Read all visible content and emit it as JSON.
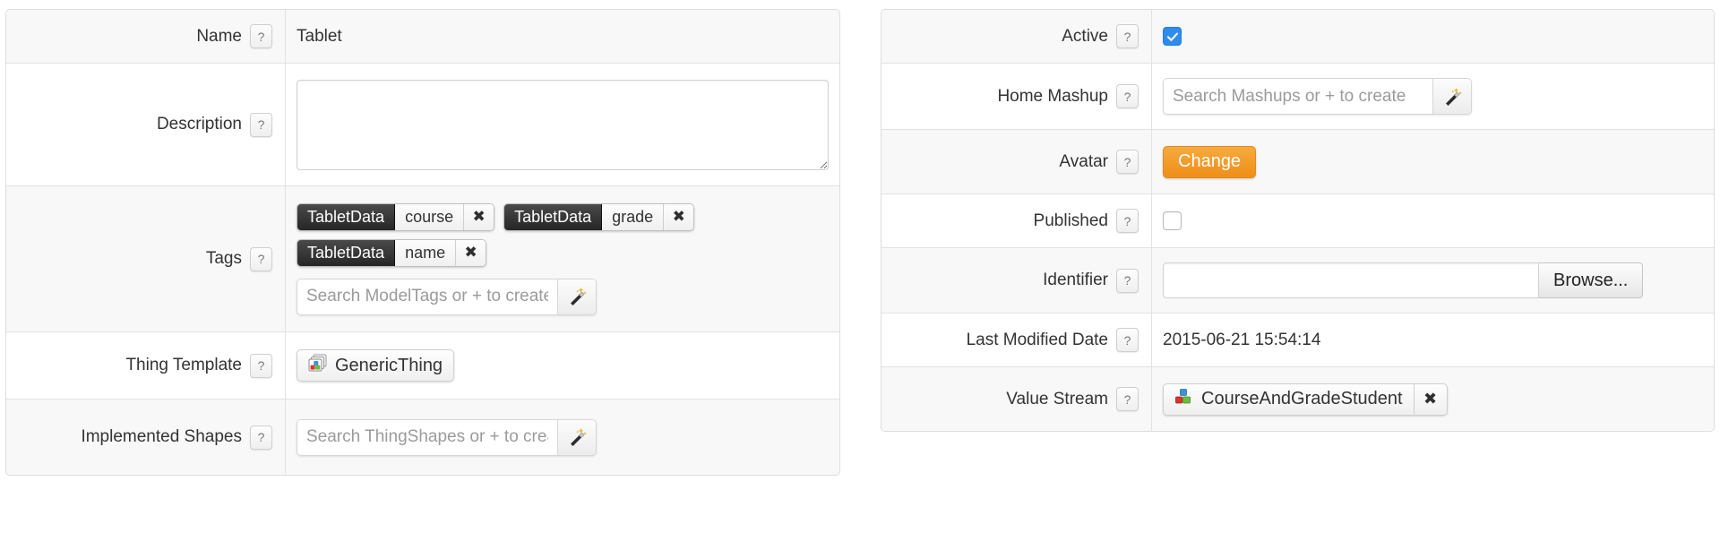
{
  "left_panel": {
    "rows": [
      {
        "label": "Name",
        "help": "?",
        "type": "text",
        "value": "Tablet"
      },
      {
        "label": "Description",
        "help": "?",
        "type": "textarea",
        "value": ""
      },
      {
        "label": "Tags",
        "help": "?",
        "type": "tags",
        "tags": [
          {
            "vocabulary": "TabletData",
            "term": "course",
            "remove_icon": "✖"
          },
          {
            "vocabulary": "TabletData",
            "term": "grade",
            "remove_icon": "✖"
          },
          {
            "vocabulary": "TabletData",
            "term": "name",
            "remove_icon": "✖"
          }
        ],
        "search_placeholder": "Search ModelTags or + to create",
        "search_value": "",
        "wand_icon": "magic-wand-icon"
      },
      {
        "label": "Thing Template",
        "help": "?",
        "type": "chip",
        "chip_label": "GenericThing",
        "chip_icon": "thing-template-icon"
      },
      {
        "label": "Implemented Shapes",
        "help": "?",
        "type": "search",
        "search_placeholder": "Search ThingShapes or + to create",
        "search_value": "",
        "wand_icon": "magic-wand-icon"
      }
    ]
  },
  "right_panel": {
    "rows": [
      {
        "label": "Active",
        "help": "?",
        "type": "checkbox",
        "checked": true
      },
      {
        "label": "Home Mashup",
        "help": "?",
        "type": "search",
        "search_placeholder": "Search Mashups or + to create",
        "search_value": "",
        "wand_icon": "magic-wand-icon"
      },
      {
        "label": "Avatar",
        "help": "?",
        "type": "button",
        "button_label": "Change"
      },
      {
        "label": "Published",
        "help": "?",
        "type": "checkbox",
        "checked": false
      },
      {
        "label": "Identifier",
        "help": "?",
        "type": "identifier",
        "value": "",
        "browse_label": "Browse..."
      },
      {
        "label": "Last Modified Date",
        "help": "?",
        "type": "text",
        "value": "2015-06-21 15:54:14"
      },
      {
        "label": "Value Stream",
        "help": "?",
        "type": "chip-removable",
        "chip_label": "CourseAndGradeStudent",
        "chip_icon": "value-stream-icon",
        "remove_icon": "✖"
      }
    ]
  },
  "colors": {
    "accent_orange": "#ef8e18",
    "checkbox_blue": "#2f8ced",
    "tag_dark": "#262626",
    "panel_border": "#dddddd",
    "row_shade": "#f8f8f8"
  }
}
